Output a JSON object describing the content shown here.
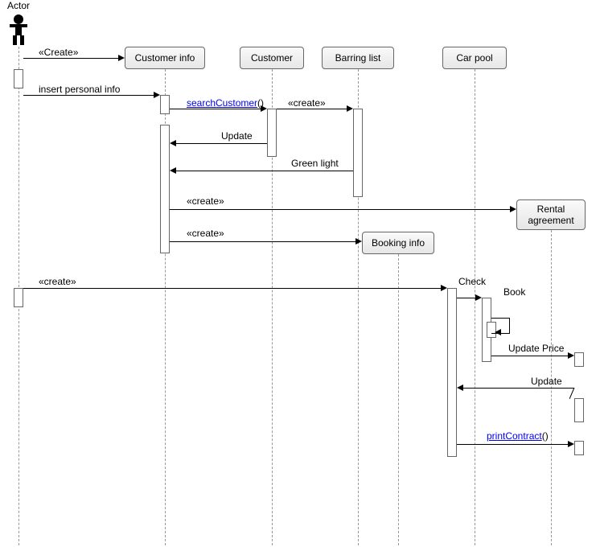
{
  "diagram_type": "UML Sequence Diagram",
  "actor": {
    "name": "Actor"
  },
  "lifelines": {
    "customer_info": "Customer info",
    "customer": "Customer",
    "barring_list": "Barring list",
    "car_pool": "Car pool",
    "rental_agreement": "Rental\nagreement",
    "booking_info": "Booking info"
  },
  "messages": {
    "m1": "«Create»",
    "m2": "insert personal info",
    "m3": "searchCustomer",
    "m4": "«create»",
    "m5": "Update",
    "m6": "Green light",
    "m7": "«create»",
    "m8": "«create»",
    "m9": "«create»",
    "m10": "Check",
    "m11": "Book",
    "m12": "Update Price",
    "m13": "Update",
    "m14": "printContract"
  }
}
